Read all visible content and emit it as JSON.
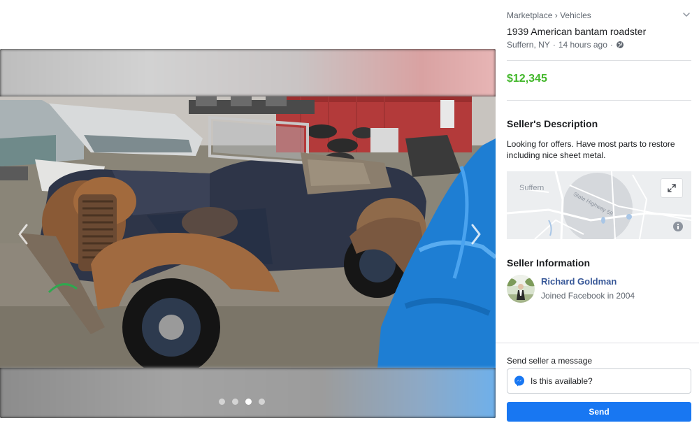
{
  "breadcrumb": {
    "marketplace": "Marketplace",
    "separator": "›",
    "category": "Vehicles"
  },
  "listing": {
    "title": "1939 American bantam roadster",
    "location": "Suffern, NY",
    "time_ago": "14 hours ago",
    "dot": "·",
    "price": "$12,345",
    "price_color": "#42b72a"
  },
  "description": {
    "heading": "Seller's Description",
    "text": "Looking for offers.  Have most parts to restore including nice sheet metal."
  },
  "map": {
    "town_label": "Suffern",
    "road_label": "State Highway 59"
  },
  "seller": {
    "heading": "Seller Information",
    "name": "Richard Goldman",
    "joined": "Joined Facebook in 2004"
  },
  "message": {
    "label": "Send seller a message",
    "input_value": "Is this available?",
    "send_label": "Send",
    "send_color": "#1877f2"
  },
  "gallery": {
    "photo_count": 4,
    "active_photo": 3
  },
  "icons": {
    "chevron": "chevron-down-icon",
    "globe": "globe-icon",
    "expand": "expand-icon",
    "info": "info-icon",
    "messenger": "messenger-icon",
    "prev": "chevron-left-icon",
    "next": "chevron-right-icon"
  }
}
